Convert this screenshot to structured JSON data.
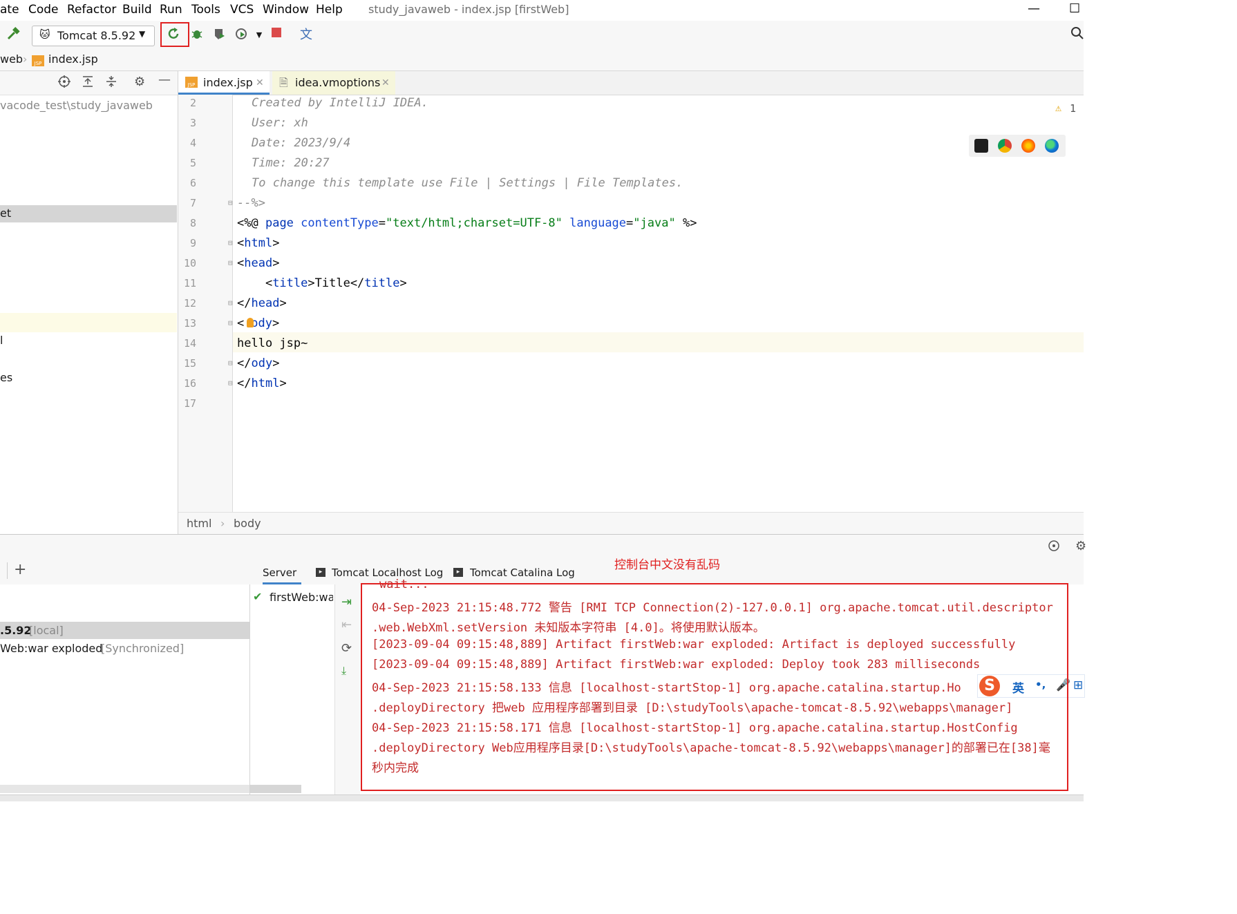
{
  "menu": {
    "items": [
      "ate",
      "Code",
      "Refactor",
      "Build",
      "Run",
      "Tools",
      "VCS",
      "Window",
      "Help"
    ],
    "window_title": "study_javaweb - index.jsp [firstWeb]",
    "minimize": "—",
    "maximize": "☐"
  },
  "toolbar": {
    "run_config": "Tomcat 8.5.92"
  },
  "navbar": {
    "crumbs": [
      "web",
      "index.jsp"
    ]
  },
  "project": {
    "rows": [
      "vacode_test\\study_javaweb",
      "et",
      "l",
      "es"
    ]
  },
  "editor": {
    "tabs": [
      "index.jsp",
      "idea.vmoptions"
    ],
    "warning_count": "1",
    "line_numbers": [
      "2",
      "3",
      "4",
      "5",
      "6",
      "7",
      "8",
      "9",
      "10",
      "11",
      "12",
      "13",
      "14",
      "15",
      "16",
      "17"
    ],
    "comment_lines": [
      "Created by IntelliJ IDEA.",
      "User: xh",
      "Date: 2023/9/4",
      "Time: 20:27",
      "To change this template use File | Settings | File Templates."
    ],
    "comment_close": "--%>",
    "directive": {
      "open": "<%@",
      "kw": "page",
      "attr1": "contentType",
      "val1": "\"text/html;charset=UTF-8\"",
      "attr2": "language",
      "val2": "\"java\"",
      "close": "%>"
    },
    "tags": {
      "html": "html",
      "head": "head",
      "title": "title",
      "title_text": "Title",
      "body_tail": "ody"
    },
    "body_text": "hello jsp~",
    "breadcrumb": [
      "html",
      "body"
    ]
  },
  "services": {
    "tree": {
      "server": ".5.92",
      "server_suffix": "[local]",
      "artifact": "Web:war exploded",
      "artifact_suffix": "[Synchronized]"
    },
    "tabs": [
      "Server",
      "Tomcat Localhost Log",
      "Tomcat Catalina Log"
    ],
    "deployment": "firstWeb:war",
    "annotation": "控制台中文没有乱码",
    "console_lines": [
      "wait...",
      "04-Sep-2023 21:15:48.772 警告 [RMI TCP Connection(2)-127.0.0.1] org.apache.tomcat.util.descriptor",
      " .web.WebXml.setVersion 未知版本字符串 [4.0]。将使用默认版本。",
      "[2023-09-04 09:15:48,889] Artifact firstWeb:war exploded: Artifact is deployed successfully",
      "[2023-09-04 09:15:48,889] Artifact firstWeb:war exploded: Deploy took 283 milliseconds",
      "04-Sep-2023 21:15:58.133 信息 [localhost-startStop-1] org.apache.catalina.startup.Ho",
      " .deployDirectory 把web 应用程序部署到目录 [D:\\studyTools\\apache-tomcat-8.5.92\\webapps\\manager]",
      "04-Sep-2023 21:15:58.171 信息 [localhost-startStop-1] org.apache.catalina.startup.HostConfig",
      " .deployDirectory Web应用程序目录[D:\\studyTools\\apache-tomcat-8.5.92\\webapps\\manager]的部署已在[38]毫",
      " 秒内完成"
    ],
    "ime": {
      "lang": "英",
      "punct": "•,"
    }
  },
  "colors": {
    "accent_red": "#e02020",
    "console_text": "#c32b2b",
    "tag_blue": "#0033b3",
    "string_green": "#067d17"
  }
}
